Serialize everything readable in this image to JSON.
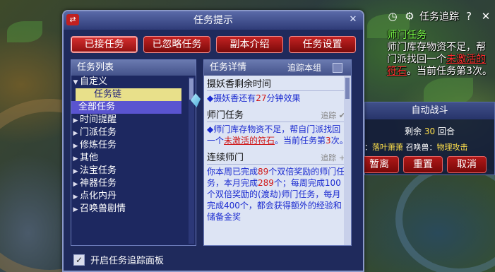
{
  "tracker": {
    "title": "任务追踪",
    "lines": [
      {
        "text": "师门任务",
        "kind": "head"
      },
      {
        "text": "师门库存物资不足，帮",
        "kind": "normal"
      },
      {
        "text": "门派找回一个",
        "kind": "normal",
        "red": "未激活的"
      },
      {
        "text": "符石",
        "kind": "red",
        "rest": "。当前任务第3次。"
      }
    ]
  },
  "battle": {
    "title": "自动战斗",
    "remain_label": "剩余",
    "remain_num": "30",
    "remain_unit": "回合",
    "row2_prefix": "物：",
    "row2_a": "落叶萧萧",
    "row2_mid": " 召唤兽：",
    "row2_b": "物理攻击",
    "btn_leave": "暂离",
    "btn_reset": "重置",
    "btn_cancel": "取消"
  },
  "dialog": {
    "title": "任务提示",
    "tabs": [
      "已接任务",
      "已忽略任务",
      "副本介绍",
      "任务设置"
    ],
    "list_header": "任务列表",
    "list": [
      {
        "label": "自定义",
        "arrow": "▼",
        "type": "parent"
      },
      {
        "label": "任务链",
        "type": "sub"
      },
      {
        "label": "全部任务",
        "type": "sel"
      },
      {
        "label": "时间提醒",
        "arrow": "▶",
        "type": "item"
      },
      {
        "label": "门派任务",
        "arrow": "▶",
        "type": "item"
      },
      {
        "label": "修炼任务",
        "arrow": "▶",
        "type": "item"
      },
      {
        "label": "其他",
        "arrow": "▶",
        "type": "item"
      },
      {
        "label": "法宝任务",
        "arrow": "▶",
        "type": "item"
      },
      {
        "label": "神器任务",
        "arrow": "▶",
        "type": "item"
      },
      {
        "label": "点化内丹",
        "arrow": "▶",
        "type": "item"
      },
      {
        "label": "召唤兽剧情",
        "arrow": "▶",
        "type": "item"
      }
    ],
    "detail_header": "任务详情",
    "track_group": "追踪本组",
    "sections": {
      "s1_title": "摄妖香剩余时间",
      "s1_a": "◆摄妖香还有",
      "s1_n": "27",
      "s1_b": "分钟效果",
      "s2_title": "师门任务",
      "s2_tag": "追踪 ✔",
      "s2_a": "◆师门库存物资不足，帮自门派找回一个",
      "s2_u": "未激活的符石",
      "s2_b": "。当前任务第",
      "s2_n": "3",
      "s2_c": "次。",
      "s3_title": "连续师门",
      "s3_tag": "追踪 +",
      "s3_a": "你本周已完成",
      "s3_n1": "89",
      "s3_b": "个双倍奖励的师门任务，本月完成",
      "s3_n2": "289",
      "s3_c": "个；每周完成100个双倍奖励的(渡劫)师门任务，每月完成400个，都会获得额外的经验和储备金奖"
    },
    "bottom_option": "开启任务追踪面板",
    "bottom_checked": "✓"
  }
}
